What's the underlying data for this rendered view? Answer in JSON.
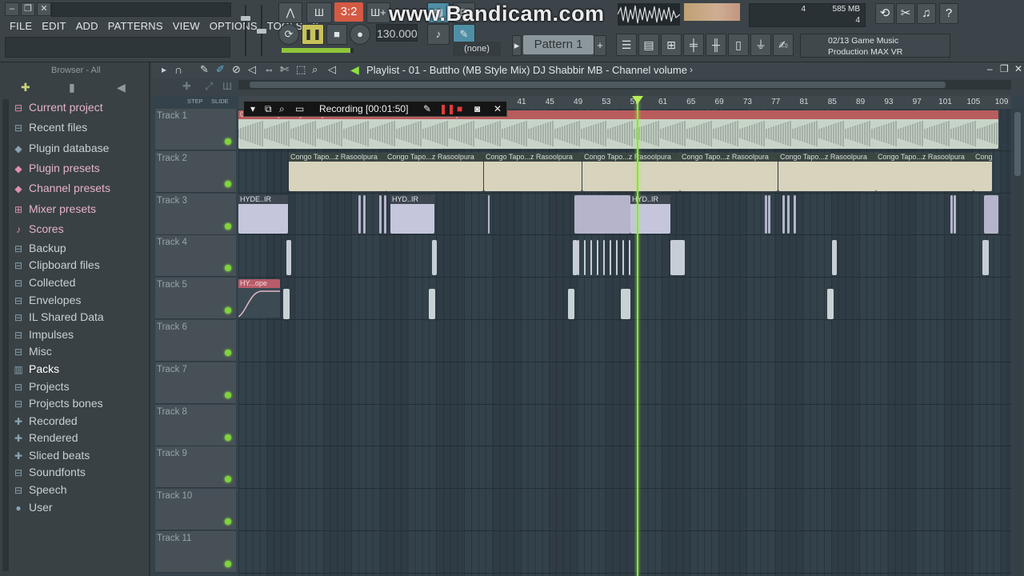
{
  "watermark": "www.Bandicam.com",
  "menu": [
    "FILE",
    "EDIT",
    "ADD",
    "PATTERNS",
    "VIEW",
    "OPTIONS",
    "TOOLS",
    "?"
  ],
  "transport": {
    "song_position": "3:2",
    "tempo": "130.000",
    "snap": "(none)",
    "pattern": "Pattern 1"
  },
  "cpu": {
    "memory": "585 MB",
    "cpu_value": "4",
    "voices": "4"
  },
  "news": {
    "line1": "02/13  Game Music",
    "line2": "Production MAX VR"
  },
  "browser": {
    "header": "Browser - All",
    "items": [
      {
        "label": "Current project",
        "icon": "project-icon",
        "style": "pink"
      },
      {
        "label": "Recent files",
        "icon": "folder-icon",
        "style": "normal"
      },
      {
        "label": "Plugin database",
        "icon": "plugin-icon",
        "style": "normal"
      },
      {
        "label": "Plugin presets",
        "icon": "plugin-icon",
        "style": "pink"
      },
      {
        "label": "Channel presets",
        "icon": "plugin-icon",
        "style": "pink"
      },
      {
        "label": "Mixer presets",
        "icon": "mixer-icon",
        "style": "pink"
      },
      {
        "label": "Scores",
        "icon": "note-icon",
        "style": "pink"
      },
      {
        "label": "Backup",
        "icon": "folder-icon",
        "style": "normal"
      },
      {
        "label": "Clipboard files",
        "icon": "folder-icon",
        "style": "normal"
      },
      {
        "label": "Collected",
        "icon": "folder-icon",
        "style": "normal"
      },
      {
        "label": "Envelopes",
        "icon": "folder-icon",
        "style": "normal"
      },
      {
        "label": "IL Shared Data",
        "icon": "folder-icon",
        "style": "normal"
      },
      {
        "label": "Impulses",
        "icon": "folder-icon",
        "style": "normal"
      },
      {
        "label": "Misc",
        "icon": "folder-icon",
        "style": "normal"
      },
      {
        "label": "Packs",
        "icon": "pack-icon",
        "style": "selected"
      },
      {
        "label": "Projects",
        "icon": "folder-icon",
        "style": "normal"
      },
      {
        "label": "Projects bones",
        "icon": "folder-icon",
        "style": "normal"
      },
      {
        "label": "Recorded",
        "icon": "recorded-icon",
        "style": "normal"
      },
      {
        "label": "Rendered",
        "icon": "recorded-icon",
        "style": "normal"
      },
      {
        "label": "Sliced beats",
        "icon": "recorded-icon",
        "style": "normal"
      },
      {
        "label": "Soundfonts",
        "icon": "folder-icon",
        "style": "normal"
      },
      {
        "label": "Speech",
        "icon": "folder-icon",
        "style": "normal"
      },
      {
        "label": "User",
        "icon": "user-icon",
        "style": "normal"
      }
    ]
  },
  "playlist": {
    "title": "Playlist - 01 - Buttho (MB Style Mix) DJ Shabbir MB - Channel volume",
    "ruler": [
      "41",
      "45",
      "49",
      "53",
      "57",
      "61",
      "65",
      "69",
      "73",
      "77",
      "81",
      "85",
      "89",
      "93",
      "97",
      "101",
      "105",
      "109"
    ],
    "tracks": [
      "Track 1",
      "Track 2",
      "Track 3",
      "Track 4",
      "Track 5",
      "Track 6",
      "Track 7",
      "Track 8",
      "Track 9",
      "Track 10",
      "Track 11"
    ],
    "track1_clip": "01 - Buttho (MB Style Mix) DJ Shabbir MB - Channel volume envelope",
    "track2_clip": "Congo Tapo...z Rasoolpura",
    "track3_clip_a": "HYDE..IR",
    "track3_clip_b": "HYD..IR",
    "track5_clip": "HY...ope",
    "step_label": "STEP",
    "slide_label": "SLIDE"
  },
  "recording": {
    "label": "Recording [00:01:50]"
  },
  "colors": {
    "accent": "#8ee23a",
    "clip_audio": "#c9d4c8",
    "clip_pattern": "#c5c6dc",
    "clip_header_red": "#b85c5c"
  }
}
